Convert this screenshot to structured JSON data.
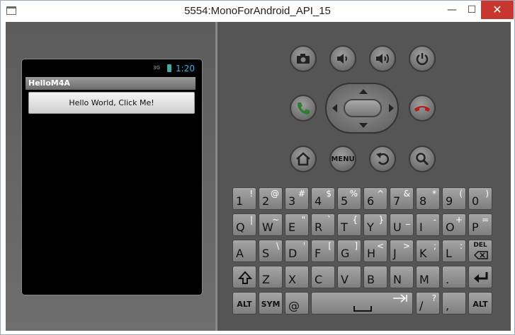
{
  "window": {
    "title": "5554:MonoForAndroid_API_15",
    "min_glyph": "—",
    "max_glyph": "☐",
    "close_glyph": "✕"
  },
  "phone": {
    "signal": "3G",
    "clock": "1:20",
    "app_title": "HelloM4A",
    "button_label": "Hello World, Click Me!"
  },
  "controls": {
    "icons": [
      "camera-icon",
      "volume-down-icon",
      "volume-up-icon",
      "power-icon",
      "call-icon",
      "dpad",
      "end-call-icon",
      "home-icon",
      "menu-button",
      "back-icon",
      "search-icon"
    ],
    "menu_label": "MENU",
    "call_color": "#2e7d32",
    "endcall_color": "#b71c1c"
  },
  "keyboard": {
    "rows": [
      [
        {
          "p": "1",
          "s": "!"
        },
        {
          "p": "2",
          "s": "@"
        },
        {
          "p": "3",
          "s": "#"
        },
        {
          "p": "4",
          "s": "$"
        },
        {
          "p": "5",
          "s": "%"
        },
        {
          "p": "6",
          "s": "^"
        },
        {
          "p": "7",
          "s": "&"
        },
        {
          "p": "8",
          "s": "*"
        },
        {
          "p": "9",
          "s": "("
        },
        {
          "p": "0",
          "s": ")"
        }
      ],
      [
        {
          "p": "Q",
          "s": "|"
        },
        {
          "p": "W",
          "s": "~"
        },
        {
          "p": "E",
          "s": "\""
        },
        {
          "p": "R",
          "s": "`"
        },
        {
          "p": "T",
          "s": "{"
        },
        {
          "p": "Y",
          "s": "}"
        },
        {
          "p": "U",
          "s": "_"
        },
        {
          "p": "I",
          "s": "-"
        },
        {
          "p": "O",
          "s": "+"
        },
        {
          "p": "P",
          "s": "="
        }
      ],
      [
        {
          "p": "A",
          "s": ""
        },
        {
          "p": "S",
          "s": "\\"
        },
        {
          "p": "D",
          "s": "'"
        },
        {
          "p": "F",
          "s": "["
        },
        {
          "p": "G",
          "s": "]"
        },
        {
          "p": "H",
          "s": "<"
        },
        {
          "p": "J",
          "s": ">"
        },
        {
          "p": "K",
          "s": ";"
        },
        {
          "p": "L",
          "s": ":"
        },
        {
          "c": "DEL"
        }
      ],
      [
        {
          "icon": "shift-icon"
        },
        {
          "p": "Z",
          "s": ""
        },
        {
          "p": "X",
          "s": ""
        },
        {
          "p": "C",
          "s": ""
        },
        {
          "p": "V",
          "s": ""
        },
        {
          "p": "B",
          "s": ""
        },
        {
          "p": "N",
          "s": ""
        },
        {
          "p": "M",
          "s": ""
        },
        {
          "p": ".",
          "s": ""
        },
        {
          "icon": "enter-icon"
        }
      ]
    ],
    "bottom": {
      "alt_left": "ALT",
      "sym": "SYM",
      "at": "@",
      "slash": "/",
      "slash_s": "?",
      "comma": ",",
      "alt_right": "ALT"
    }
  }
}
